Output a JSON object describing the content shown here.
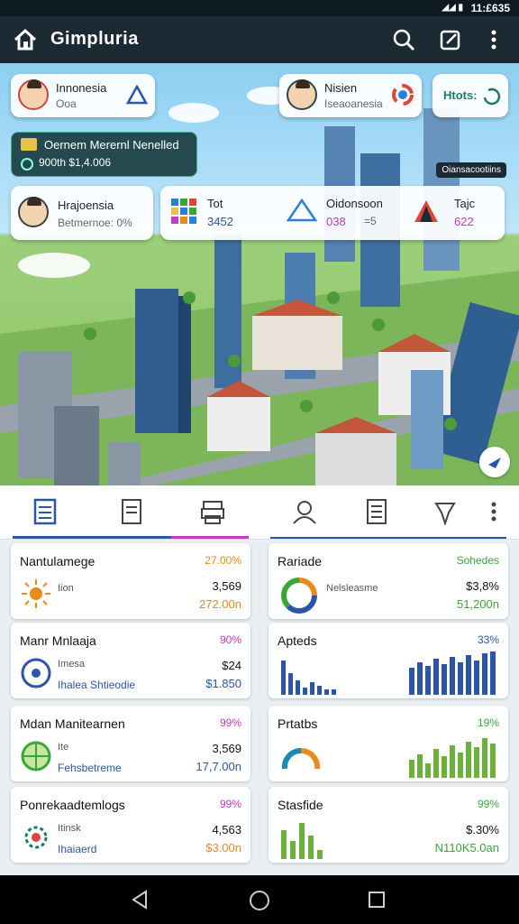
{
  "status": {
    "time": "11:£635"
  },
  "app": {
    "title": "Gimpluria"
  },
  "overlay": {
    "p1": {
      "name": "Innonesia",
      "sub": "Ooa"
    },
    "p2": {
      "name": "Nisien",
      "sub": "Iseaoanesia"
    },
    "p3": {
      "name": "Htots:"
    },
    "banner": {
      "line1": "Oernem Merernl Nenelled",
      "line2": "900th $1,4.006"
    },
    "pill": "Oiansacootiins",
    "p4": {
      "name": "Hrajoensia",
      "sub": "Betmernoe: 0%"
    },
    "s1": {
      "label": "Tot",
      "value": "3452"
    },
    "s2": {
      "label": "Oidonsoon",
      "value": "038",
      "value2": "=5"
    },
    "s3": {
      "label": "Tajc",
      "value": "622"
    }
  },
  "cards": [
    {
      "name": "Nantulamege",
      "pct": "27.00%",
      "sub": "Iion",
      "v1": "3,569",
      "v2": "272.00n",
      "pct_color": "#e98a1a",
      "v2_color": "#e98a1a"
    },
    {
      "name": "Rariade",
      "pct": "Sohedes",
      "sub": "Nelsleasme",
      "v1": "$3,8%",
      "v2": "51,200n",
      "pct_color": "#3aa63a",
      "v2_color": "#3aa63a"
    },
    {
      "name": "Manr Mnlaaja",
      "pct": "90%",
      "sub": "Imesa",
      "sub2": "Ihalea Shtieodie",
      "v1": "$24",
      "v2": "$1.850",
      "pct_color": "#c43bc4",
      "v2_color": "#2a55a8"
    },
    {
      "name": "Apteds",
      "pct": "33%",
      "v1": "",
      "v2": "",
      "pct_color": "#2a55a8",
      "v2_color": "#2a55a8"
    },
    {
      "name": "Mdan Manitearnen",
      "pct": "99%",
      "sub": "Ite",
      "sub2": "Fehsbetreme",
      "v1": "3,569",
      "v2": "17,7.00n",
      "pct_color": "#c43bc4",
      "v2_color": "#2a55a8"
    },
    {
      "name": "Prtatbs",
      "pct": "19%",
      "v1": "",
      "v2": "",
      "pct_color": "#3aa63a",
      "v2_color": "#3aa63a"
    },
    {
      "name": "Ponrekaadtemlogs",
      "pct": "99%",
      "sub": "Itinsk",
      "sub2": "Ihaiaerd",
      "v1": "4,563",
      "v2": "$3.00n",
      "pct_color": "#c43bc4",
      "v2_color": "#e98a1a"
    },
    {
      "name": "Stasfide",
      "pct": "99%",
      "sub": "",
      "v1": "$.30%",
      "v2": "N110K5.0an",
      "pct_color": "#3aa63a",
      "v2_color": "#3aa63a"
    }
  ],
  "colors": {
    "appbar": "#1c2a33",
    "accent_blue": "#2a55a8",
    "accent_green": "#3aa63a",
    "accent_pink": "#c43bc4"
  }
}
